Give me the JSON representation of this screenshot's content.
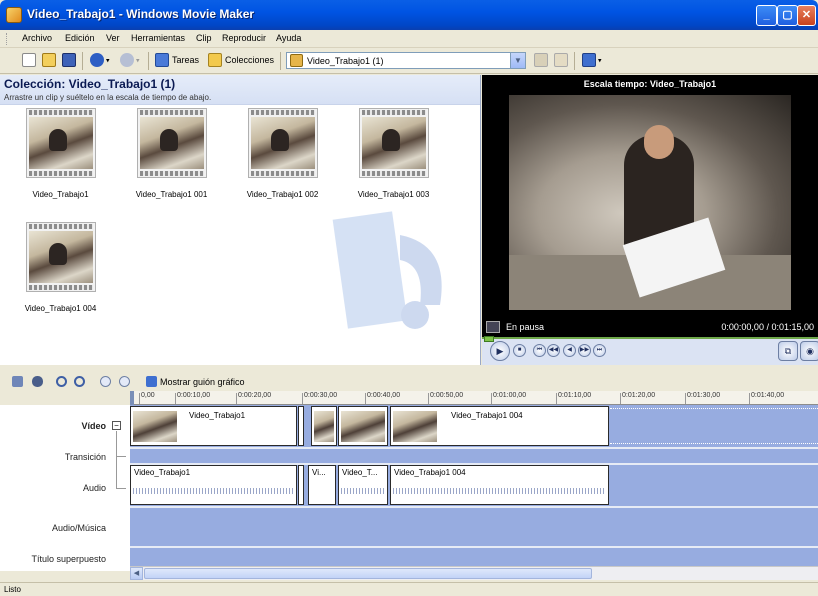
{
  "window": {
    "title": "Video_Trabajo1 - Windows Movie Maker"
  },
  "menu": [
    "Archivo",
    "Edición",
    "Ver",
    "Herramientas",
    "Clip",
    "Reproducir",
    "Ayuda"
  ],
  "toolbar": {
    "tasks_label": "Tareas",
    "collections_label": "Colecciones",
    "collection_select": "Video_Trabajo1 (1)"
  },
  "collection": {
    "title": "Colección: Video_Trabajo1 (1)",
    "subtitle": "Arrastre un clip y suéltelo en la escala de tiempo de abajo.",
    "clips": [
      "Video_Trabajo1",
      "Video_Trabajo1 001",
      "Video_Trabajo1 002",
      "Video_Trabajo1 003",
      "Video_Trabajo1 004"
    ]
  },
  "preview": {
    "title": "Escala tiempo: Video_Trabajo1",
    "status": "En pausa",
    "time": "0:00:00,00 / 0:01:15,00"
  },
  "timeline": {
    "storyboard_label": "Mostrar guión gráfico",
    "ticks": [
      "0,00",
      "0:00:10,00",
      "0:00:20,00",
      "0:00:30,00",
      "0:00:40,00",
      "0:00:50,00",
      "0:01:00,00",
      "0:01:10,00",
      "0:01:20,00",
      "0:01:30,00",
      "0:01:40,00"
    ],
    "tracks": {
      "video": "Vídeo",
      "transition": "Transición",
      "audio": "Audio",
      "music": "Audio/Música",
      "title_overlay": "Título superpuesto"
    },
    "video_clips": [
      "Video_Trabajo1",
      "Video_Trabajo1 004"
    ],
    "audio_clips": [
      "Video_Trabajo1",
      "Vi...",
      "Video_T...",
      "Video_Trabajo1 004"
    ]
  },
  "status": {
    "text": "Listo"
  }
}
